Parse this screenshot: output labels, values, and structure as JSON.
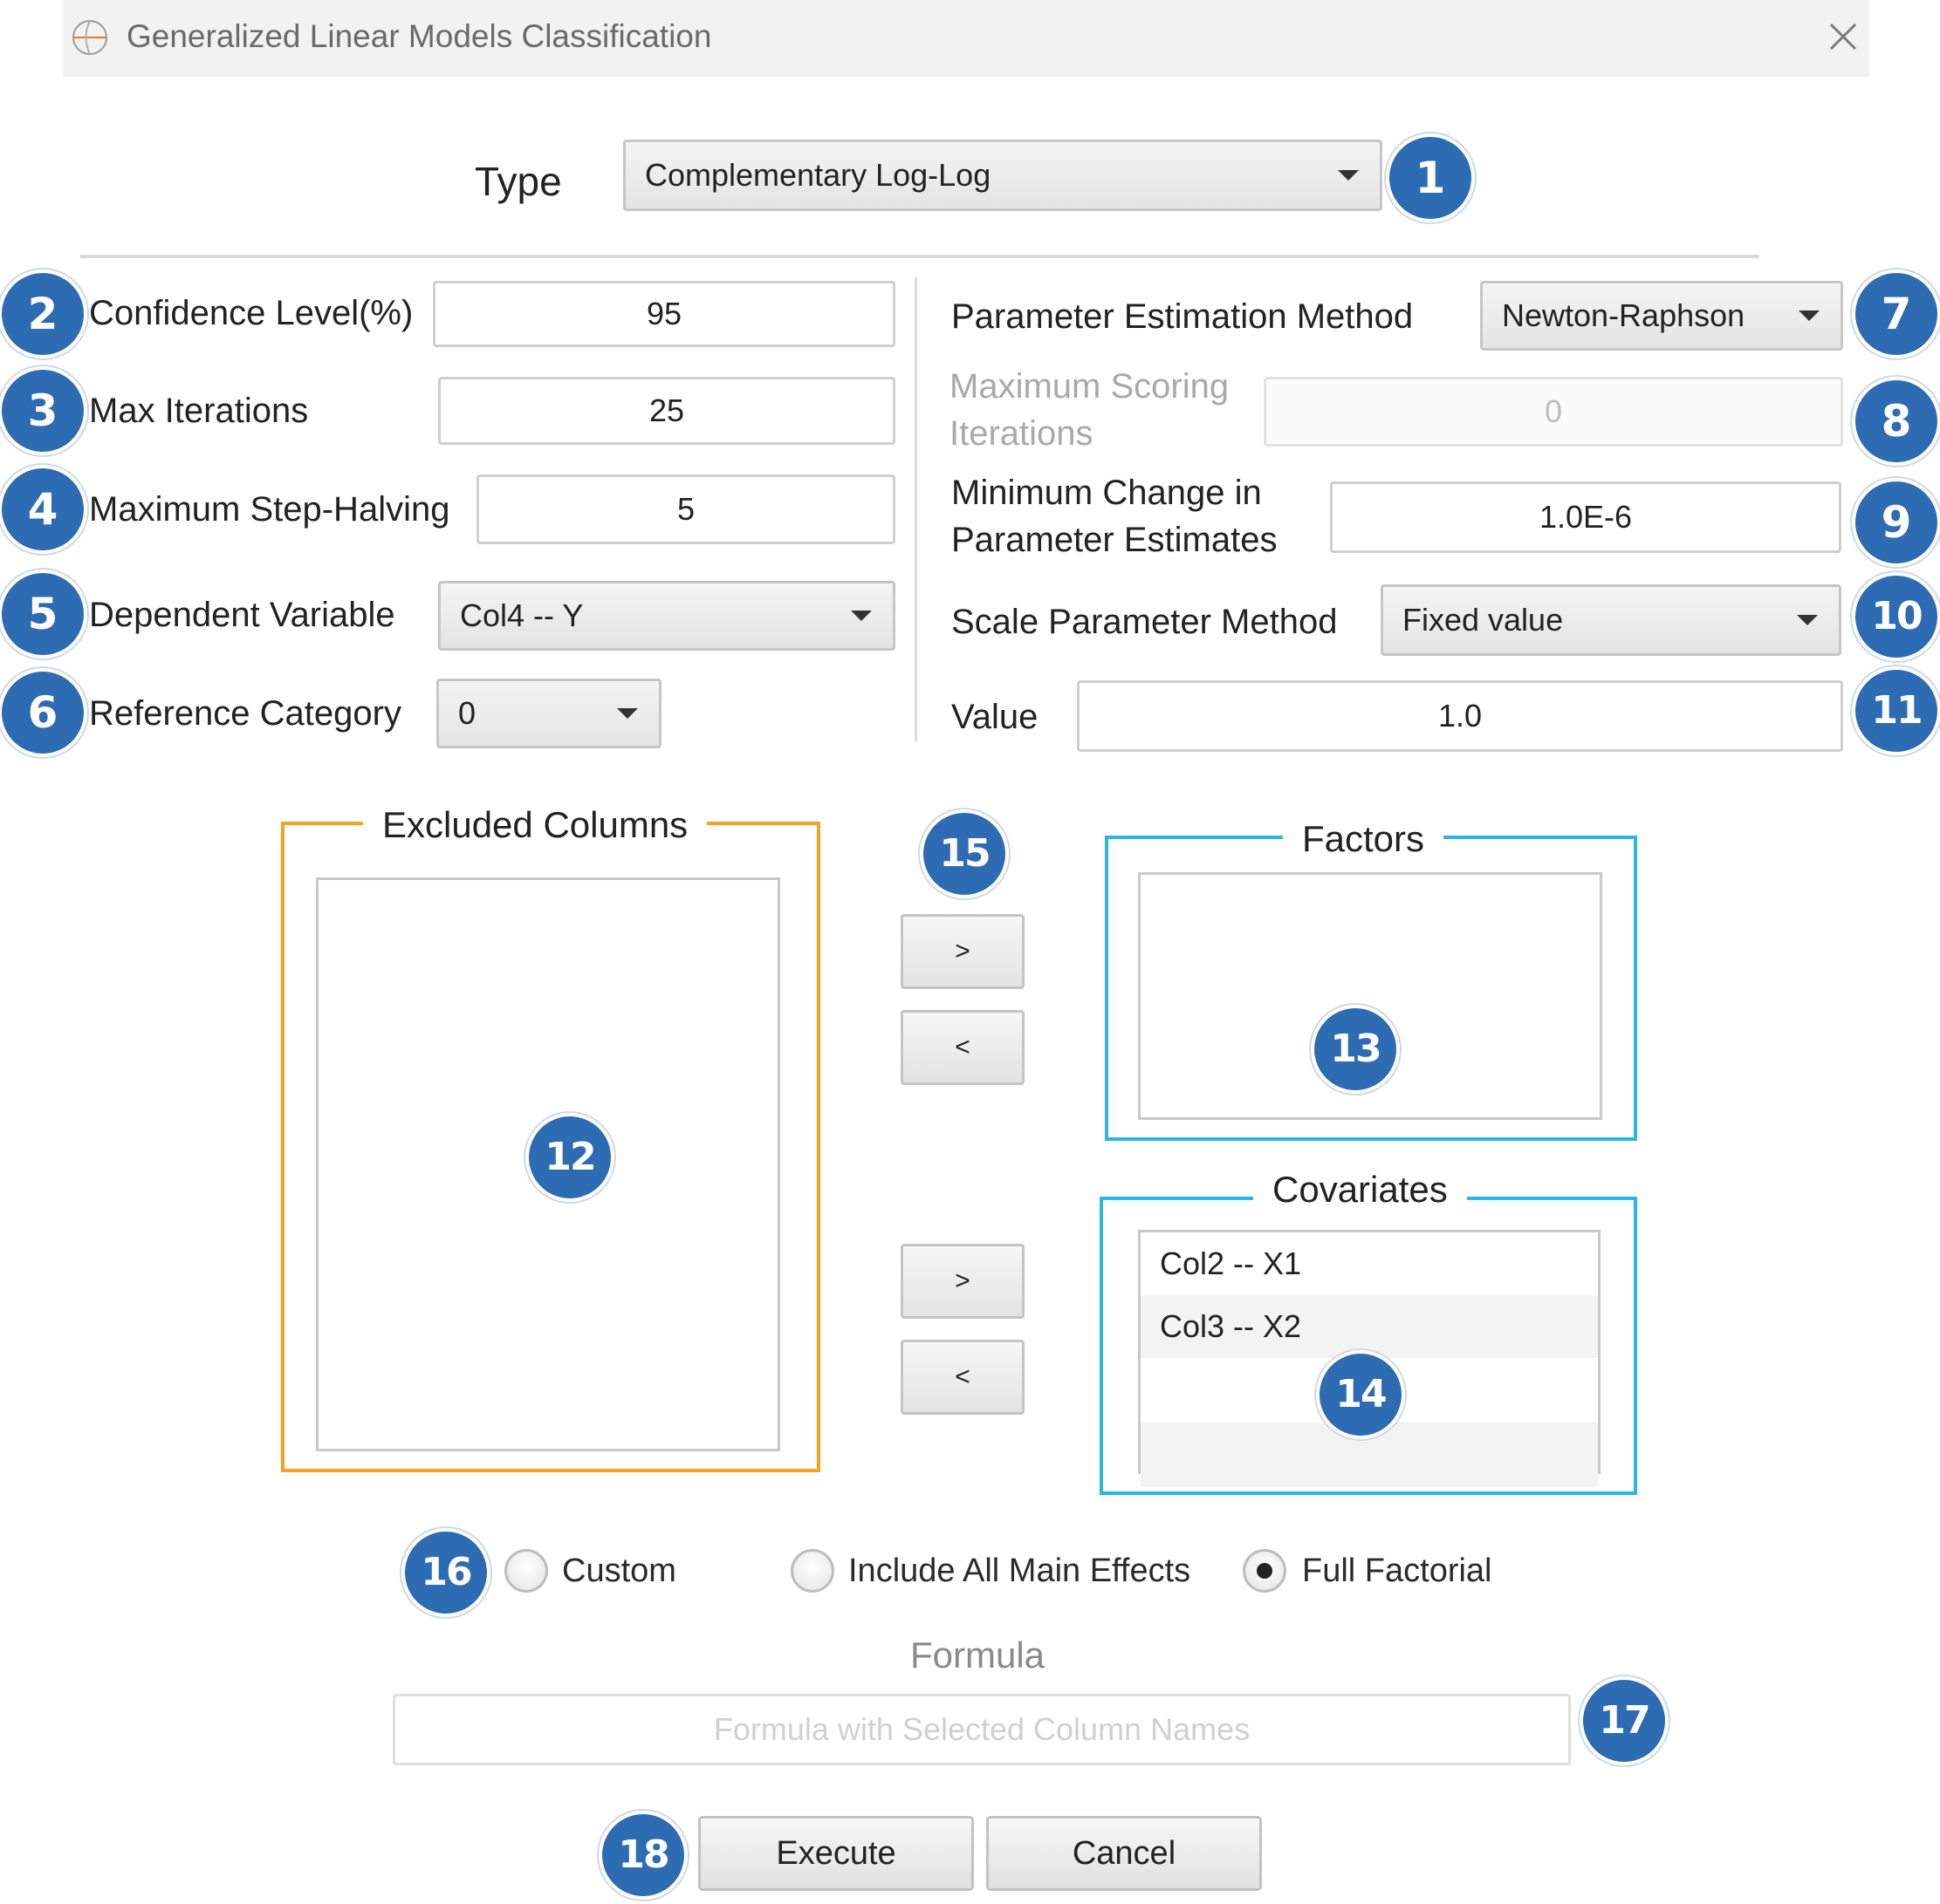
{
  "window": {
    "title": "Generalized Linear Models Classification",
    "icon": "app-logo-icon",
    "close_icon": "close-icon"
  },
  "type": {
    "label": "Type",
    "value": "Complementary Log-Log"
  },
  "left_fields": {
    "confidence_label": "Confidence Level(%)",
    "confidence_value": "95",
    "max_iter_label": "Max Iterations",
    "max_iter_value": "25",
    "step_halving_label": "Maximum Step-Halving",
    "step_halving_value": "5",
    "dependent_label": "Dependent Variable",
    "dependent_value": "Col4 -- Y",
    "reference_label": "Reference Category",
    "reference_value": "0"
  },
  "right_fields": {
    "estimation_label": "Parameter Estimation Method",
    "estimation_value": "Newton-Raphson",
    "scoring_label_line1": "Maximum Scoring",
    "scoring_label_line2": "Iterations",
    "scoring_value": "0",
    "min_change_label_line1": "Minimum Change in",
    "min_change_label_line2": "Parameter Estimates",
    "min_change_value": "1.0E-6",
    "scale_label": "Scale Parameter Method",
    "scale_value": "Fixed value",
    "value_label": "Value",
    "value_value": "1.0"
  },
  "excluded": {
    "title": "Excluded Columns",
    "items": []
  },
  "factors": {
    "title": "Factors",
    "items": []
  },
  "covariates": {
    "title": "Covariates",
    "items": [
      "Col2 -- X1",
      "Col3 -- X2"
    ]
  },
  "arrows": {
    "add": ">",
    "remove": "<"
  },
  "model": {
    "options": [
      "Custom",
      "Include All Main Effects",
      "Full Factorial"
    ],
    "selected": "Full Factorial"
  },
  "formula": {
    "title": "Formula",
    "placeholder": "Formula with Selected Column Names",
    "value": ""
  },
  "buttons": {
    "execute": "Execute",
    "cancel": "Cancel"
  },
  "badges": [
    "1",
    "2",
    "3",
    "4",
    "5",
    "6",
    "7",
    "8",
    "9",
    "10",
    "11",
    "12",
    "13",
    "14",
    "15",
    "16",
    "17",
    "18"
  ],
  "colors": {
    "badge": "#2d6bb3",
    "excluded_frame": "#f5a31e",
    "factor_frame": "#2ab5e8"
  }
}
